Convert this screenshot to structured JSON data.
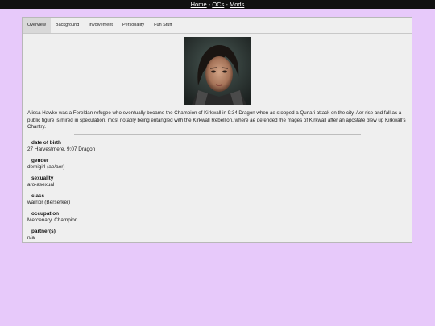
{
  "nav": {
    "items": [
      "Home",
      "OCs",
      "Mods"
    ],
    "separator": "-"
  },
  "tabs": [
    {
      "label": "Overview",
      "active": true
    },
    {
      "label": "Background",
      "active": false
    },
    {
      "label": "Involvement",
      "active": false
    },
    {
      "label": "Personality",
      "active": false
    },
    {
      "label": "Fun Stuff",
      "active": false
    }
  ],
  "bio": "Alissa Hawke was a Fereldan refugee who eventually became the Champion of Kirkwall in 9:34 Dragon when ae stopped a Qunari attack on the city. Aer rise and fall as a public figure is mired in speculation, most notably being entangled with the Kirkwall Rebellion, where ae defended the mages of Kirkwall after an apostate blew up Kirkwall's Chantry.",
  "fields": [
    {
      "label": "date of birth",
      "value": "27 Harvestmere, 9:07 Dragon"
    },
    {
      "label": "gender",
      "value": "demigirl (ae/aer)"
    },
    {
      "label": "sexuality",
      "value": "aro-asexual"
    },
    {
      "label": "class",
      "value": "warrior (Berserker)"
    },
    {
      "label": "occupation",
      "value": "Mercenary, Champion"
    },
    {
      "label": "partner(s)",
      "value": "n/a"
    }
  ],
  "colors": {
    "page_bg": "#e7c9fa",
    "topbar_bg": "#111111",
    "panel_bg": "#efefef"
  }
}
